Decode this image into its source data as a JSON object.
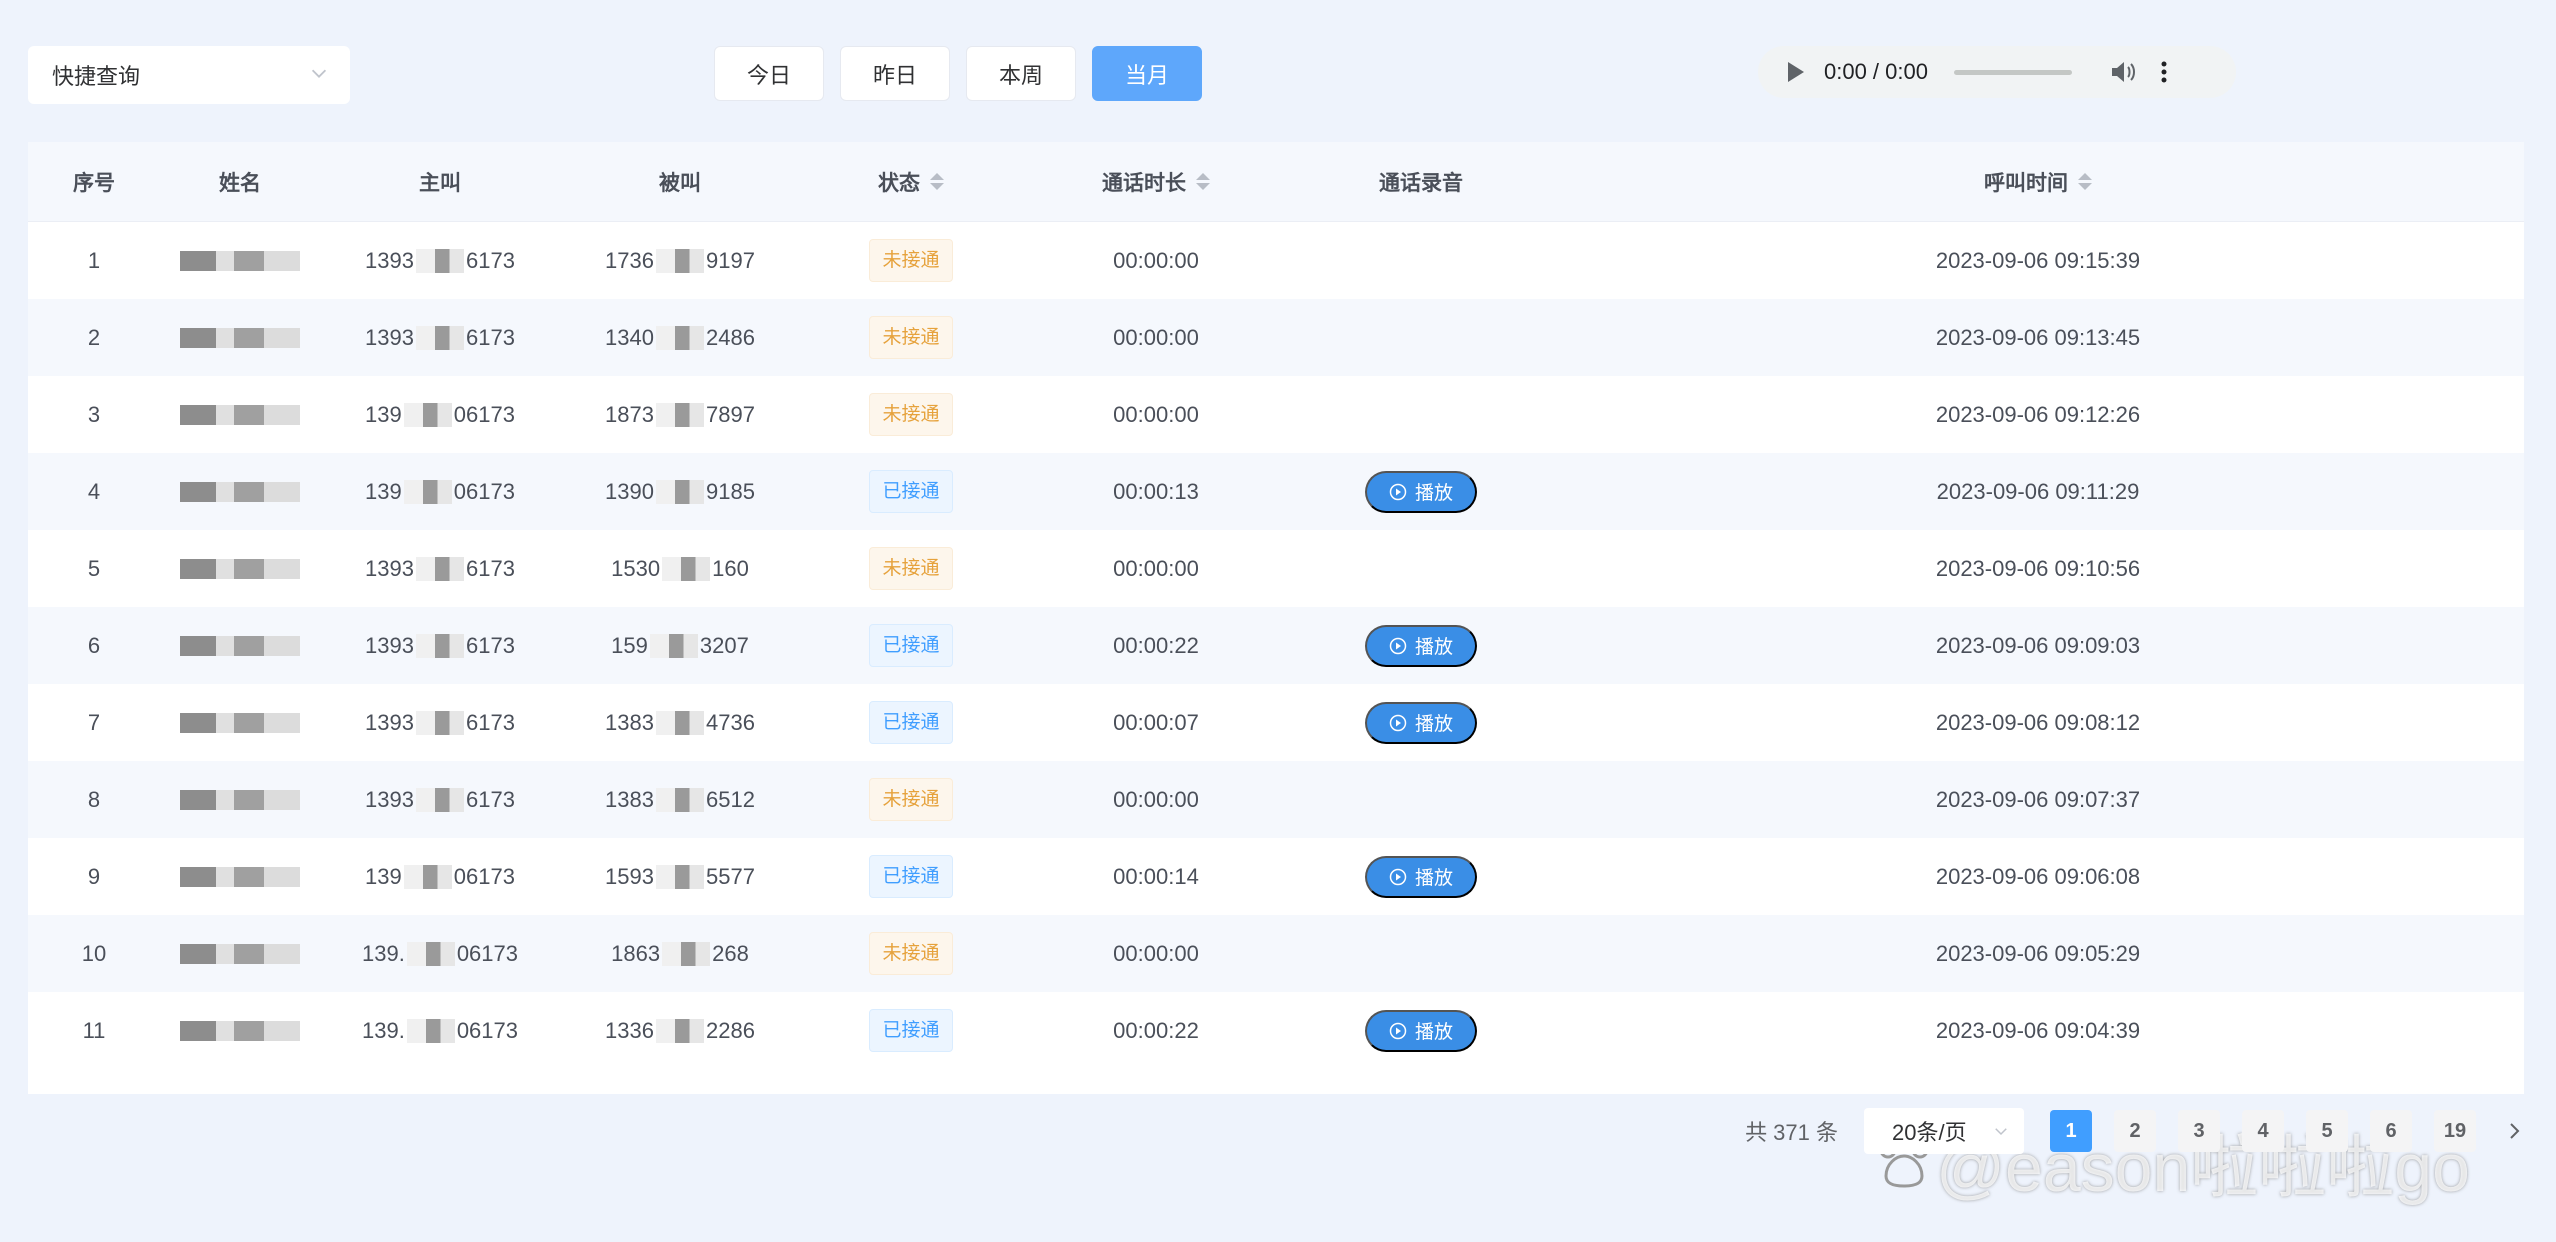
{
  "toolbar": {
    "quick_query_placeholder": "快捷查询",
    "date_buttons": [
      "今日",
      "昨日",
      "本周",
      "当月"
    ],
    "active_date_button": "当月"
  },
  "audio": {
    "time": "0:00 / 0:00"
  },
  "table": {
    "headers": {
      "index": "序号",
      "name": "姓名",
      "caller": "主叫",
      "callee": "被叫",
      "status": "状态",
      "duration": "通话时长",
      "recording": "通话录音",
      "call_time": "呼叫时间"
    },
    "play_label": "播放",
    "rows": [
      {
        "idx": "1",
        "caller_a": "1393",
        "caller_b": "6173",
        "callee_a": "1736",
        "callee_b": "9197",
        "status": "未接通",
        "ok": false,
        "duration": "00:00:00",
        "time": "2023-09-06 09:15:39"
      },
      {
        "idx": "2",
        "caller_a": "1393",
        "caller_b": "6173",
        "callee_a": "1340",
        "callee_b": "2486",
        "status": "未接通",
        "ok": false,
        "duration": "00:00:00",
        "time": "2023-09-06 09:13:45"
      },
      {
        "idx": "3",
        "caller_a": "139",
        "caller_b": "06173",
        "callee_a": "1873",
        "callee_b": "7897",
        "status": "未接通",
        "ok": false,
        "duration": "00:00:00",
        "time": "2023-09-06 09:12:26"
      },
      {
        "idx": "4",
        "caller_a": "139",
        "caller_b": "06173",
        "callee_a": "1390",
        "callee_b": "9185",
        "status": "已接通",
        "ok": true,
        "duration": "00:00:13",
        "time": "2023-09-06 09:11:29"
      },
      {
        "idx": "5",
        "caller_a": "1393",
        "caller_b": "6173",
        "callee_a": "1530",
        "callee_b": "160",
        "status": "未接通",
        "ok": false,
        "duration": "00:00:00",
        "time": "2023-09-06 09:10:56"
      },
      {
        "idx": "6",
        "caller_a": "1393",
        "caller_b": "6173",
        "callee_a": "159",
        "callee_b": "3207",
        "status": "已接通",
        "ok": true,
        "duration": "00:00:22",
        "time": "2023-09-06 09:09:03"
      },
      {
        "idx": "7",
        "caller_a": "1393",
        "caller_b": "6173",
        "callee_a": "1383",
        "callee_b": "4736",
        "status": "已接通",
        "ok": true,
        "duration": "00:00:07",
        "time": "2023-09-06 09:08:12"
      },
      {
        "idx": "8",
        "caller_a": "1393",
        "caller_b": "6173",
        "callee_a": "1383",
        "callee_b": "6512",
        "status": "未接通",
        "ok": false,
        "duration": "00:00:00",
        "time": "2023-09-06 09:07:37"
      },
      {
        "idx": "9",
        "caller_a": "139",
        "caller_b": "06173",
        "callee_a": "1593",
        "callee_b": "5577",
        "status": "已接通",
        "ok": true,
        "duration": "00:00:14",
        "time": "2023-09-06 09:06:08"
      },
      {
        "idx": "10",
        "caller_a": "139.",
        "caller_b": "06173",
        "callee_a": "1863",
        "callee_b": "268",
        "status": "未接通",
        "ok": false,
        "duration": "00:00:00",
        "time": "2023-09-06 09:05:29"
      },
      {
        "idx": "11",
        "caller_a": "139.",
        "caller_b": "06173",
        "callee_a": "1336",
        "callee_b": "2286",
        "status": "已接通",
        "ok": true,
        "duration": "00:00:22",
        "time": "2023-09-06 09:04:39"
      }
    ]
  },
  "pagination": {
    "total": "共 371 条",
    "page_size": "20条/页",
    "pages": [
      "1",
      "2",
      "3",
      "4",
      "5",
      "6",
      "19"
    ],
    "current": "1",
    "next_icon": "chevron-right-icon"
  },
  "watermark": "@eason啦啦啦go",
  "colors": {
    "primary": "#409eff",
    "active_button": "#5ea7fb",
    "tag_missed": "#e6a23c",
    "tag_connected": "#409eff",
    "background": "#eef3fc"
  }
}
